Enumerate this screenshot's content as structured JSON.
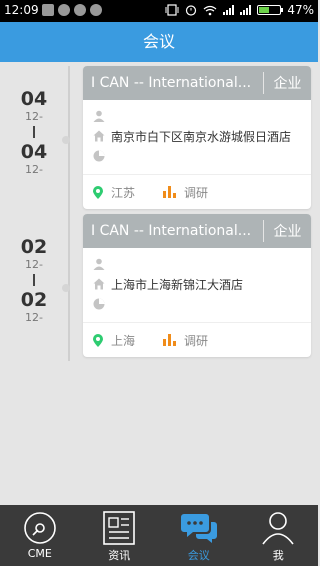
{
  "status": {
    "time": "12:09",
    "battery": "47%",
    "battery_level": 0.47
  },
  "header": {
    "title": "会议"
  },
  "events": [
    {
      "start_day": "04",
      "start_month": "12-",
      "end_day": "04",
      "end_month": "12-",
      "title": "I CAN -- International...",
      "tag": "企业",
      "person": "",
      "address": "南京市白下区南京水游城假日酒店",
      "time": "",
      "city": "江苏",
      "type": "调研"
    },
    {
      "start_day": "02",
      "start_month": "12-",
      "end_day": "02",
      "end_month": "12-",
      "title": "I CAN -- International...",
      "tag": "企业",
      "person": "",
      "address": "上海市上海新锦江大酒店",
      "time": "",
      "city": "上海",
      "type": "调研"
    }
  ],
  "tabs": [
    {
      "label": "CME",
      "icon": "disc-icon"
    },
    {
      "label": "资讯",
      "icon": "newspaper-icon"
    },
    {
      "label": "会议",
      "icon": "chat-icon",
      "active": true
    },
    {
      "label": "我",
      "icon": "person-icon"
    }
  ],
  "colors": {
    "accent": "#3a9be0",
    "location": "#2ecc71",
    "bar_chart": "#f08c1a"
  }
}
